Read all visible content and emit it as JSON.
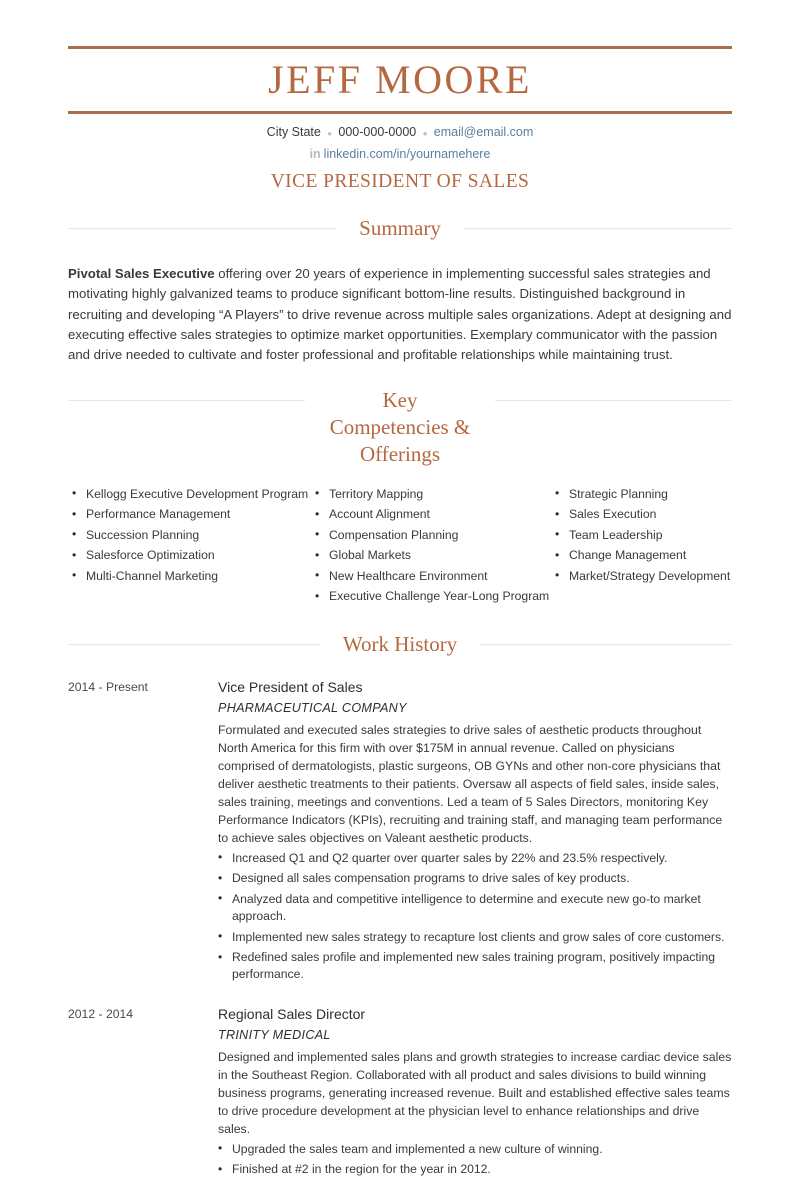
{
  "header": {
    "name": "JEFF MOORE",
    "location": "City State",
    "phone": "000-000-0000",
    "email": "email@email.com",
    "separator": "•",
    "linkedin_icon": "in",
    "linkedin": "linkedin.com/in/yournamehere",
    "headline": "VICE PRESIDENT OF SALES"
  },
  "colors": {
    "accent": "#b5683f",
    "rule": "#a9704f",
    "divider": "#ece5dd",
    "link": "#5b7f9e",
    "text": "#3a3a3a"
  },
  "summary": {
    "title": "Summary",
    "lead": "Pivotal Sales Executive",
    "body": " offering over 20 years of experience in implementing successful sales strategies and motivating highly galvanized teams to produce significant bottom-line results. Distinguished background in recruiting and developing “A Players” to drive revenue across multiple sales organizations. Adept at designing and executing effective sales strategies to optimize market opportunities. Exemplary communicator with the passion and drive needed to cultivate and foster professional and profitable relationships while maintaining trust."
  },
  "competencies": {
    "title": "Key Competencies & Offerings",
    "columns": [
      {
        "items": [
          "Kellogg Executive Development Program",
          "Performance Management",
          "Succession Planning",
          "Salesforce Optimization",
          "Multi-Channel Marketing"
        ]
      },
      {
        "items": [
          "Territory Mapping",
          "Account Alignment",
          "Compensation Planning",
          "Global Markets",
          "New Healthcare Environment",
          "Executive Challenge Year-Long Program"
        ]
      },
      {
        "items": [
          "Strategic Planning",
          "Sales Execution",
          "Team Leadership",
          "Change Management",
          "Market/Strategy Development"
        ]
      }
    ]
  },
  "work_history": {
    "title": "Work History",
    "jobs": [
      {
        "dates": "2014 - Present",
        "role": "Vice President of Sales",
        "company": "PHARMACEUTICAL COMPANY",
        "description": "Formulated and executed sales strategies to drive sales of aesthetic products throughout North America for this firm with over $175M in annual revenue. Called on physicians comprised of dermatologists, plastic surgeons, OB GYNs and other non-core physicians that deliver aesthetic treatments to their patients. Oversaw all aspects of field sales, inside sales, sales training, meetings and conventions. Led a team of 5 Sales Directors, monitoring Key Performance Indicators (KPIs), recruiting and training staff, and managing team performance to achieve sales objectives on Valeant aesthetic products.",
        "bullets": [
          "Increased Q1 and Q2 quarter over quarter sales by 22% and 23.5% respectively.",
          "Designed all sales compensation programs to drive sales of key products.",
          "Analyzed data and competitive intelligence to determine and execute new go-to market approach.",
          "Implemented new sales strategy to recapture lost clients and grow sales of core customers.",
          "Redefined sales profile and implemented new sales training program, positively impacting performance."
        ]
      },
      {
        "dates": "2012 - 2014",
        "role": "Regional Sales Director",
        "company": "TRINITY MEDICAL",
        "description": "Designed and implemented sales plans and growth strategies to increase cardiac device sales in the Southeast Region. Collaborated with all product and sales divisions to build winning business programs, generating increased revenue. Built and established effective sales teams to drive procedure development at the physician level to enhance relationships and drive sales.",
        "bullets": [
          "Upgraded the sales team and implemented a new culture of winning.",
          "Finished at #2 in the region for the year in 2012."
        ]
      }
    ]
  }
}
